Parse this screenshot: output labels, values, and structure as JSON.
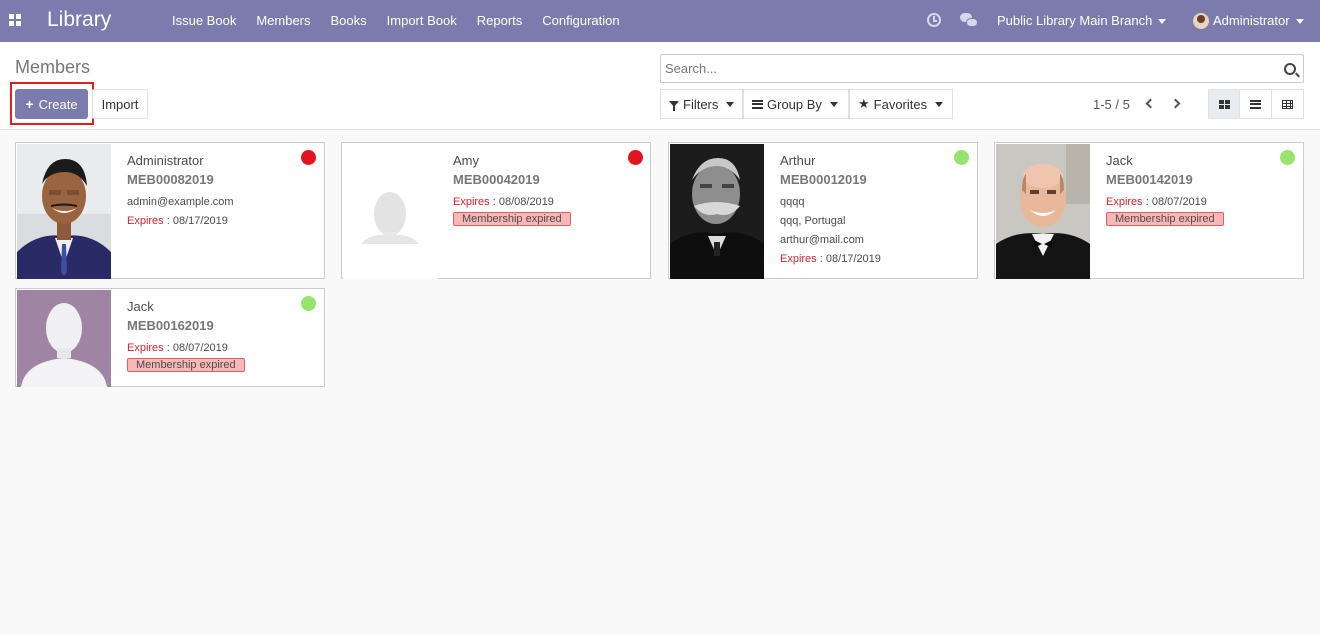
{
  "nav": {
    "brand": "Library",
    "menu": [
      "Issue Book",
      "Members",
      "Books",
      "Import Book",
      "Reports",
      "Configuration"
    ],
    "branch": "Public Library Main Branch",
    "user": "Administrator"
  },
  "control": {
    "title": "Members",
    "create_label": "Create",
    "import_label": "Import",
    "search_placeholder": "Search...",
    "filters_label": "Filters",
    "groupby_label": "Group By",
    "favorites_label": "Favorites",
    "pager": "1-5 / 5"
  },
  "colors": {
    "navbar": "#7c7bad",
    "expired": "#d9242b",
    "status_red": "#e2141e",
    "status_green": "#98e36b"
  },
  "members": [
    {
      "name": "Administrator",
      "code": "MEB00082019",
      "lines": [
        "admin@example.com"
      ],
      "expires_label": "Expires",
      "expires": " : 08/17/2019",
      "badge": "",
      "status": "red",
      "photo": "man-photo"
    },
    {
      "name": "Amy",
      "code": "MEB00042019",
      "lines": [],
      "expires_label": "Expires",
      "expires": " : 08/08/2019",
      "badge": "Membership expired",
      "status": "red",
      "photo": "placeholder"
    },
    {
      "name": "Arthur",
      "code": "MEB00012019",
      "lines": [
        "qqqq",
        "qqq, Portugal",
        "arthur@mail.com"
      ],
      "expires_label": "Expires",
      "expires": " : 08/17/2019",
      "badge": "",
      "status": "green",
      "photo": "bw-photo"
    },
    {
      "name": "Jack",
      "code": "MEB00142019",
      "lines": [],
      "expires_label": "Expires",
      "expires": " : 08/07/2019",
      "badge": "Membership expired",
      "status": "green",
      "photo": "tux-photo"
    },
    {
      "name": "Jack",
      "code": "MEB00162019",
      "lines": [],
      "expires_label": "Expires",
      "expires": " : 08/07/2019",
      "badge": "Membership expired",
      "status": "green",
      "photo": "placeholder-purple"
    }
  ]
}
